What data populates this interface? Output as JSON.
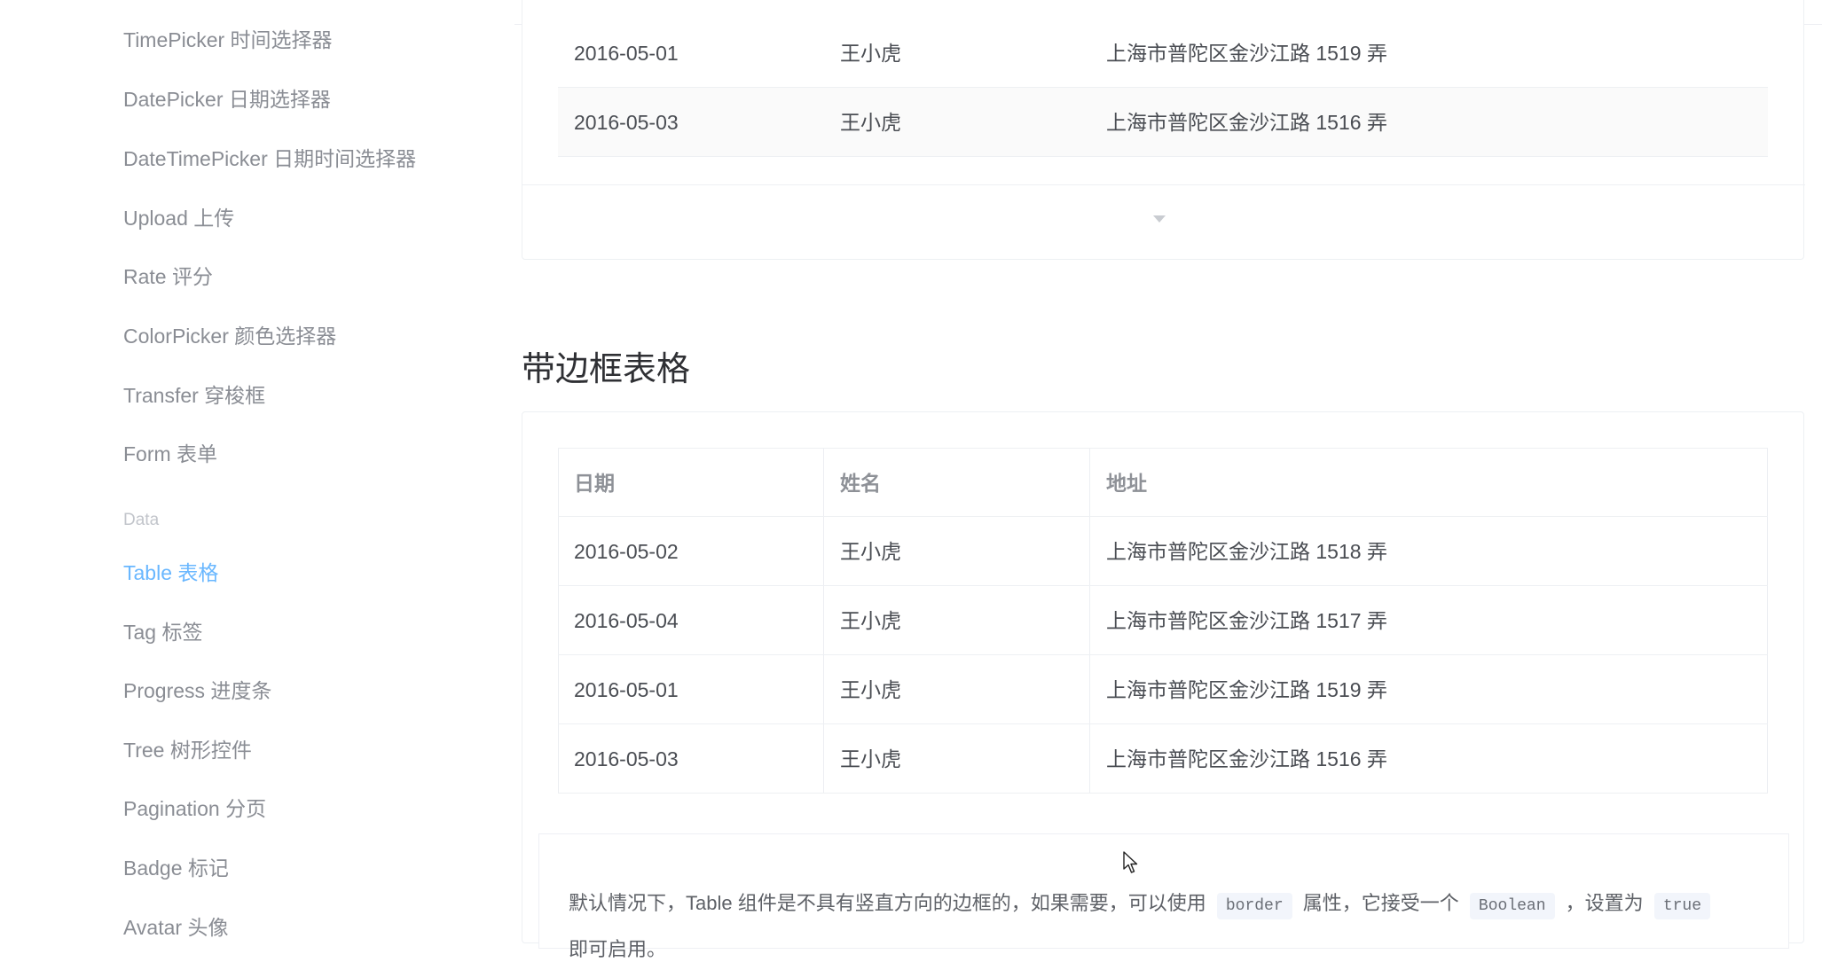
{
  "sidebar": {
    "items": [
      {
        "label": "TimePicker 时间选择器"
      },
      {
        "label": "DatePicker 日期选择器"
      },
      {
        "label": "DateTimePicker 日期时间选择器"
      },
      {
        "label": "Upload 上传"
      },
      {
        "label": "Rate 评分"
      },
      {
        "label": "ColorPicker 颜色选择器"
      },
      {
        "label": "Transfer 穿梭框"
      },
      {
        "label": "Form 表单"
      }
    ],
    "group_title": "Data",
    "data_items": [
      {
        "label": "Table 表格",
        "active": true
      },
      {
        "label": "Tag 标签"
      },
      {
        "label": "Progress 进度条"
      },
      {
        "label": "Tree 树形控件"
      },
      {
        "label": "Pagination 分页"
      },
      {
        "label": "Badge 标记"
      },
      {
        "label": "Avatar 头像"
      }
    ]
  },
  "stripe_table": {
    "rows": [
      {
        "date": "2016-05-01",
        "name": "王小虎",
        "address": "上海市普陀区金沙江路 1519 弄"
      },
      {
        "date": "2016-05-03",
        "name": "王小虎",
        "address": "上海市普陀区金沙江路 1516 弄"
      }
    ]
  },
  "border_section": {
    "title": "带边框表格",
    "headers": {
      "date": "日期",
      "name": "姓名",
      "address": "地址"
    },
    "rows": [
      {
        "date": "2016-05-02",
        "name": "王小虎",
        "address": "上海市普陀区金沙江路 1518 弄"
      },
      {
        "date": "2016-05-04",
        "name": "王小虎",
        "address": "上海市普陀区金沙江路 1517 弄"
      },
      {
        "date": "2016-05-01",
        "name": "王小虎",
        "address": "上海市普陀区金沙江路 1519 弄"
      },
      {
        "date": "2016-05-03",
        "name": "王小虎",
        "address": "上海市普陀区金沙江路 1516 弄"
      }
    ],
    "description": {
      "part1": "默认情况下，Table 组件是不具有竖直方向的边框的，如果需要，可以使用",
      "code1": "border",
      "part2": "属性，它接受一个",
      "code2": "Boolean",
      "part3": "，设置为",
      "code3": "true",
      "part4": "即可启用。"
    }
  },
  "colors": {
    "accent": "#69b7ff",
    "text": "#4a4d53",
    "muted": "#8a8d94"
  },
  "icons": {
    "expand": "caret-down-icon",
    "cursor": "mouse-pointer-icon"
  }
}
